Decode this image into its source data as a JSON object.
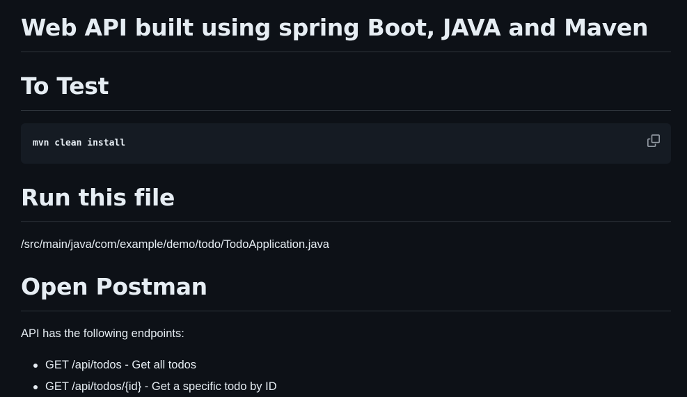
{
  "readme": {
    "title": "Web API built using spring Boot, JAVA and Maven",
    "sections": {
      "test": {
        "heading": "To Test",
        "code": "mvn clean install",
        "copy_icon": "copy-icon"
      },
      "run": {
        "heading": "Run this file",
        "path": "/src/main/java/com/example/demo/todo/TodoApplication.java"
      },
      "postman": {
        "heading": "Open Postman",
        "intro": "API has the following endpoints:",
        "endpoints": [
          "GET /api/todos - Get all todos",
          "GET /api/todos/{id} - Get a specific todo by ID"
        ]
      }
    }
  },
  "colors": {
    "background": "#0d1117",
    "text": "#e6edf3",
    "rule": "#30363d",
    "code_bg": "#151b23",
    "icon": "#9198a1"
  }
}
